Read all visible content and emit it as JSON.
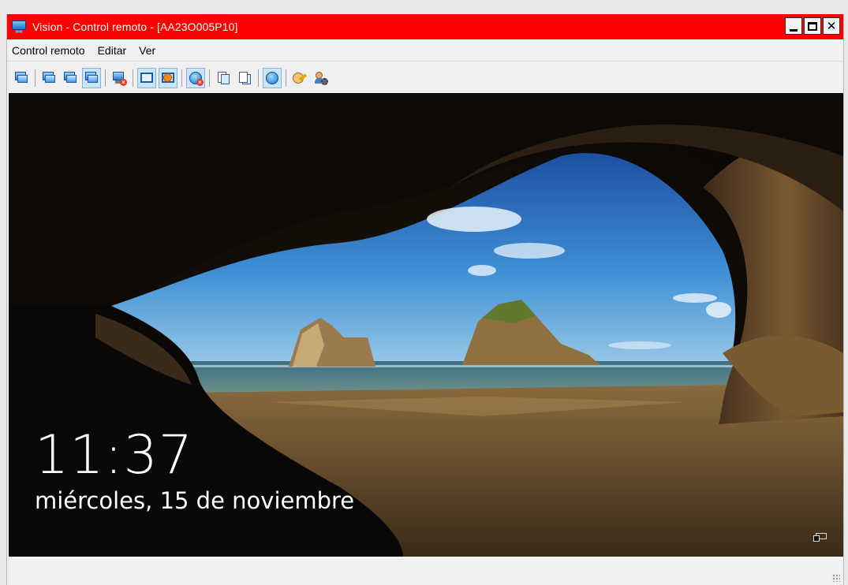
{
  "window": {
    "title": "Vision - Control remoto - [AA23O005P10]",
    "title_bar_color": "#ff0000",
    "buttons": {
      "minimize": "_",
      "maximize": "□",
      "close": "×"
    }
  },
  "menubar": {
    "items": [
      "Control remoto",
      "Editar",
      "Ver"
    ]
  },
  "toolbar": {
    "icons": [
      "remote-control-icon",
      "monitor-view-icon",
      "monitor-control-icon",
      "monitor-share-icon",
      "disconnect-icon",
      "fit-window-icon",
      "full-screen-icon",
      "blank-screen-icon",
      "copy-to-icon",
      "paste-from-icon",
      "refresh-icon",
      "chat-icon",
      "user-settings-icon"
    ]
  },
  "lockscreen": {
    "time": "11:37",
    "date": "miércoles, 15 de noviembre"
  }
}
